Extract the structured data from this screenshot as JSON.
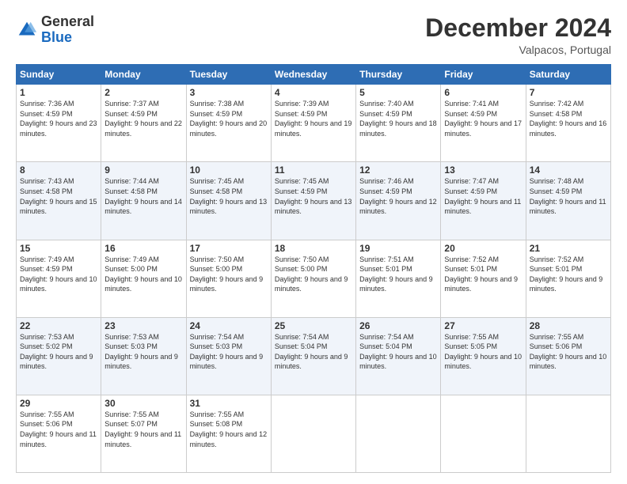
{
  "logo": {
    "general": "General",
    "blue": "Blue"
  },
  "header": {
    "month_title": "December 2024",
    "location": "Valpacos, Portugal"
  },
  "weekdays": [
    "Sunday",
    "Monday",
    "Tuesday",
    "Wednesday",
    "Thursday",
    "Friday",
    "Saturday"
  ],
  "weeks": [
    [
      {
        "day": "1",
        "sunrise": "7:36 AM",
        "sunset": "4:59 PM",
        "daylight": "9 hours and 23 minutes."
      },
      {
        "day": "2",
        "sunrise": "7:37 AM",
        "sunset": "4:59 PM",
        "daylight": "9 hours and 22 minutes."
      },
      {
        "day": "3",
        "sunrise": "7:38 AM",
        "sunset": "4:59 PM",
        "daylight": "9 hours and 20 minutes."
      },
      {
        "day": "4",
        "sunrise": "7:39 AM",
        "sunset": "4:59 PM",
        "daylight": "9 hours and 19 minutes."
      },
      {
        "day": "5",
        "sunrise": "7:40 AM",
        "sunset": "4:59 PM",
        "daylight": "9 hours and 18 minutes."
      },
      {
        "day": "6",
        "sunrise": "7:41 AM",
        "sunset": "4:59 PM",
        "daylight": "9 hours and 17 minutes."
      },
      {
        "day": "7",
        "sunrise": "7:42 AM",
        "sunset": "4:58 PM",
        "daylight": "9 hours and 16 minutes."
      }
    ],
    [
      {
        "day": "8",
        "sunrise": "7:43 AM",
        "sunset": "4:58 PM",
        "daylight": "9 hours and 15 minutes."
      },
      {
        "day": "9",
        "sunrise": "7:44 AM",
        "sunset": "4:58 PM",
        "daylight": "9 hours and 14 minutes."
      },
      {
        "day": "10",
        "sunrise": "7:45 AM",
        "sunset": "4:58 PM",
        "daylight": "9 hours and 13 minutes."
      },
      {
        "day": "11",
        "sunrise": "7:45 AM",
        "sunset": "4:59 PM",
        "daylight": "9 hours and 13 minutes."
      },
      {
        "day": "12",
        "sunrise": "7:46 AM",
        "sunset": "4:59 PM",
        "daylight": "9 hours and 12 minutes."
      },
      {
        "day": "13",
        "sunrise": "7:47 AM",
        "sunset": "4:59 PM",
        "daylight": "9 hours and 11 minutes."
      },
      {
        "day": "14",
        "sunrise": "7:48 AM",
        "sunset": "4:59 PM",
        "daylight": "9 hours and 11 minutes."
      }
    ],
    [
      {
        "day": "15",
        "sunrise": "7:49 AM",
        "sunset": "4:59 PM",
        "daylight": "9 hours and 10 minutes."
      },
      {
        "day": "16",
        "sunrise": "7:49 AM",
        "sunset": "5:00 PM",
        "daylight": "9 hours and 10 minutes."
      },
      {
        "day": "17",
        "sunrise": "7:50 AM",
        "sunset": "5:00 PM",
        "daylight": "9 hours and 9 minutes."
      },
      {
        "day": "18",
        "sunrise": "7:50 AM",
        "sunset": "5:00 PM",
        "daylight": "9 hours and 9 minutes."
      },
      {
        "day": "19",
        "sunrise": "7:51 AM",
        "sunset": "5:01 PM",
        "daylight": "9 hours and 9 minutes."
      },
      {
        "day": "20",
        "sunrise": "7:52 AM",
        "sunset": "5:01 PM",
        "daylight": "9 hours and 9 minutes."
      },
      {
        "day": "21",
        "sunrise": "7:52 AM",
        "sunset": "5:01 PM",
        "daylight": "9 hours and 9 minutes."
      }
    ],
    [
      {
        "day": "22",
        "sunrise": "7:53 AM",
        "sunset": "5:02 PM",
        "daylight": "9 hours and 9 minutes."
      },
      {
        "day": "23",
        "sunrise": "7:53 AM",
        "sunset": "5:03 PM",
        "daylight": "9 hours and 9 minutes."
      },
      {
        "day": "24",
        "sunrise": "7:54 AM",
        "sunset": "5:03 PM",
        "daylight": "9 hours and 9 minutes."
      },
      {
        "day": "25",
        "sunrise": "7:54 AM",
        "sunset": "5:04 PM",
        "daylight": "9 hours and 9 minutes."
      },
      {
        "day": "26",
        "sunrise": "7:54 AM",
        "sunset": "5:04 PM",
        "daylight": "9 hours and 10 minutes."
      },
      {
        "day": "27",
        "sunrise": "7:55 AM",
        "sunset": "5:05 PM",
        "daylight": "9 hours and 10 minutes."
      },
      {
        "day": "28",
        "sunrise": "7:55 AM",
        "sunset": "5:06 PM",
        "daylight": "9 hours and 10 minutes."
      }
    ],
    [
      {
        "day": "29",
        "sunrise": "7:55 AM",
        "sunset": "5:06 PM",
        "daylight": "9 hours and 11 minutes."
      },
      {
        "day": "30",
        "sunrise": "7:55 AM",
        "sunset": "5:07 PM",
        "daylight": "9 hours and 11 minutes."
      },
      {
        "day": "31",
        "sunrise": "7:55 AM",
        "sunset": "5:08 PM",
        "daylight": "9 hours and 12 minutes."
      },
      null,
      null,
      null,
      null
    ]
  ]
}
